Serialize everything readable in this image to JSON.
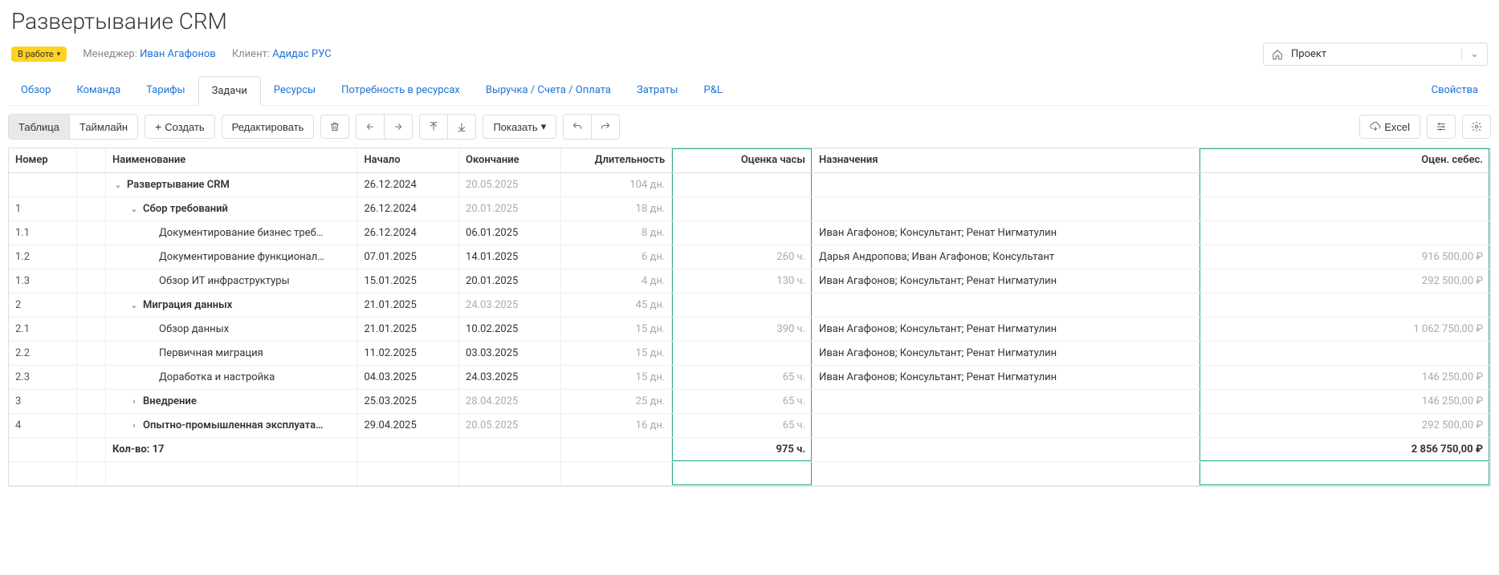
{
  "page": {
    "title": "Развертывание CRM",
    "status": "В работе",
    "manager_label": "Менеджер:",
    "manager_name": "Иван Агафонов",
    "client_label": "Клиент:",
    "client_name": "Адидас РУС",
    "project_select": "Проект"
  },
  "tabs": {
    "overview": "Обзор",
    "team": "Команда",
    "rates": "Тарифы",
    "tasks": "Задачи",
    "resources": "Ресурсы",
    "demand": "Потребность в ресурсах",
    "revenue": "Выручка / Счета / Оплата",
    "expenses": "Затраты",
    "pnl": "P&L",
    "props": "Свойства"
  },
  "toolbar": {
    "table": "Таблица",
    "timeline": "Таймлайн",
    "create": "Создать",
    "edit": "Редактировать",
    "show": "Показать",
    "excel": "Excel"
  },
  "columns": {
    "number": "Номер",
    "name": "Наименование",
    "start": "Начало",
    "end": "Окончание",
    "duration": "Длительность",
    "est_hours": "Оценка часы",
    "assignments": "Назначения",
    "est_cost": "Оцен. себес."
  },
  "rows": [
    {
      "number": "",
      "indent": 0,
      "caret": "down",
      "bold": true,
      "name": "Развертывание CRM",
      "start": "26.12.2024",
      "end": "20.05.2025",
      "end_muted": true,
      "duration": "104 дн.",
      "dur_muted": true,
      "hours": "",
      "assign": "",
      "cost": ""
    },
    {
      "number": "1",
      "indent": 1,
      "caret": "down",
      "bold": true,
      "name": "Сбор требований",
      "start": "26.12.2024",
      "end": "20.01.2025",
      "end_muted": true,
      "duration": "18 дн.",
      "dur_muted": true,
      "hours": "",
      "assign": "",
      "cost": ""
    },
    {
      "number": "1.1",
      "indent": 2,
      "caret": "",
      "name": "Документирование бизнес треб…",
      "start": "26.12.2024",
      "end": "06.01.2025",
      "duration": "8 дн.",
      "dur_muted": true,
      "hours": "",
      "assign": "Иван Агафонов; Консультант; Ренат Нигматулин",
      "cost": ""
    },
    {
      "number": "1.2",
      "indent": 2,
      "caret": "",
      "name": "Документирование функционал…",
      "start": "07.01.2025",
      "end": "14.01.2025",
      "duration": "6 дн.",
      "dur_muted": true,
      "hours": "260 ч.",
      "hours_muted": true,
      "assign": "Дарья Андропова; Иван Агафонов; Консультант",
      "cost": "916 500,00 ₽",
      "cost_muted": true
    },
    {
      "number": "1.3",
      "indent": 2,
      "caret": "",
      "name": "Обзор ИТ инфраструктуры",
      "start": "15.01.2025",
      "end": "20.01.2025",
      "duration": "4 дн.",
      "dur_muted": true,
      "hours": "130 ч.",
      "hours_muted": true,
      "assign": "Иван Агафонов; Консультант; Ренат Нигматулин",
      "cost": "292 500,00 ₽",
      "cost_muted": true
    },
    {
      "number": "2",
      "indent": 1,
      "caret": "down",
      "bold": true,
      "name": "Миграция данных",
      "start": "21.01.2025",
      "end": "24.03.2025",
      "end_muted": true,
      "duration": "45 дн.",
      "dur_muted": true,
      "hours": "",
      "assign": "",
      "cost": ""
    },
    {
      "number": "2.1",
      "indent": 2,
      "caret": "",
      "name": "Обзор данных",
      "start": "21.01.2025",
      "end": "10.02.2025",
      "duration": "15 дн.",
      "dur_muted": true,
      "hours": "390 ч.",
      "hours_muted": true,
      "assign": "Иван Агафонов; Консультант; Ренат Нигматулин",
      "cost": "1 062 750,00 ₽",
      "cost_muted": true
    },
    {
      "number": "2.2",
      "indent": 2,
      "caret": "",
      "name": "Первичная миграция",
      "start": "11.02.2025",
      "end": "03.03.2025",
      "duration": "15 дн.",
      "dur_muted": true,
      "hours": "",
      "assign": "Иван Агафонов; Консультант; Ренат Нигматулин",
      "cost": ""
    },
    {
      "number": "2.3",
      "indent": 2,
      "caret": "",
      "name": "Доработка и настройка",
      "start": "04.03.2025",
      "end": "24.03.2025",
      "duration": "15 дн.",
      "dur_muted": true,
      "hours": "65 ч.",
      "hours_muted": true,
      "assign": "Иван Агафонов; Консультант; Ренат Нигматулин",
      "cost": "146 250,00 ₽",
      "cost_muted": true
    },
    {
      "number": "3",
      "indent": 1,
      "caret": "right",
      "bold": true,
      "name": "Внедрение",
      "start": "25.03.2025",
      "end": "28.04.2025",
      "end_muted": true,
      "duration": "25 дн.",
      "dur_muted": true,
      "hours": "65 ч.",
      "hours_muted": true,
      "assign": "",
      "cost": "146 250,00 ₽",
      "cost_muted": true
    },
    {
      "number": "4",
      "indent": 1,
      "caret": "right",
      "bold": true,
      "name": "Опытно-промышленная эксплуата…",
      "start": "29.04.2025",
      "end": "20.05.2025",
      "end_muted": true,
      "duration": "16 дн.",
      "dur_muted": true,
      "hours": "65 ч.",
      "hours_muted": true,
      "assign": "",
      "cost": "292 500,00 ₽",
      "cost_muted": true
    }
  ],
  "footer": {
    "count_label": "Кол-во: 17",
    "hours_total": "975 ч.",
    "cost_total": "2 856 750,00 ₽"
  }
}
